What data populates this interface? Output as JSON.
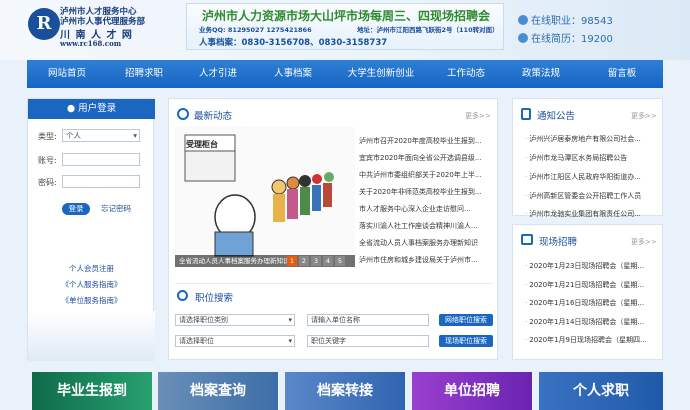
{
  "header": {
    "logo_char": "R",
    "logo_lines": [
      "泸州市人才服务中心",
      "泸州市人事代理服务部",
      "川 南 人 才 网",
      "www.rc168.com"
    ],
    "banner_title": "泸州市人力资源市场大山坪市场每周三、四现场招聘会",
    "banner_qq": "业务QQ: 81295027 1275421866",
    "banner_addr": "地址：泸州市江阳西路飞跃街2号（110转对面）",
    "banner_tel": "人事档案：0830-3156708、0830-3158737",
    "stat_online_job": "在线职业：98543",
    "stat_online_resume": "在线简历：19200"
  },
  "nav": [
    "网站首页",
    "招聘求职",
    "人才引进",
    "人事档案",
    "大学生创新创业",
    "工作动态",
    "政策法规",
    "留言板"
  ],
  "login": {
    "title": "用户登录",
    "type_label": "类型:",
    "type_value": "个人",
    "account_label": "账号:",
    "password_label": "密码:",
    "login_btn": "登录",
    "forgot": "忘记密码",
    "links": [
      "个人会员注册",
      "《个人服务指南》",
      "《单位服务指南》"
    ]
  },
  "news": {
    "title": "最新动态",
    "more": "更多>>",
    "sign": "受理柜台",
    "caption": "全省流动人员人事档案服务办理新知识",
    "pages": [
      "1",
      "2",
      "3",
      "4",
      "5"
    ],
    "items": [
      "泸州市召开2020年度高校毕业生报到...",
      "宜宾市2020年面向全省公开选调县级...",
      "中共泸州市委组织部关于2020年上半...",
      "关于2020年非师范类高校毕业生报到...",
      "市人才服务中心深入企业走访慰问...",
      "落实川渝人社工作座谈会精神川渝人...",
      "全省流动人员人事档案服务办理新知识",
      "泸州市住房和城乡建设局关于泸州市..."
    ]
  },
  "job_search": {
    "title": "职位搜索",
    "sel_category": "请选择职位类别",
    "unit_name": "请输入单位名称",
    "btn_online": "网络职位搜索",
    "sel_position": "请选择职位",
    "keyword": "职位关键字",
    "btn_onsite": "现场职位搜索"
  },
  "notice": {
    "title": "通知公告",
    "more": "更多>>",
    "items": [
      "泸州兴泸居泰房地产有限公司社会...",
      "泸州市龙马潭区水务局招聘公告",
      "泸州市江阳区人民政府华阳街道办...",
      "泸州高新区管委会公开招聘工作人员",
      "泸州市龙驰实业集团有限责任公司..."
    ]
  },
  "onsite": {
    "title": "现场招聘",
    "more": "更多>>",
    "items": [
      "2020年1月23日现场招聘会（星期...",
      "2020年1月21日现场招聘会（星期...",
      "2020年1月16日现场招聘会（星期...",
      "2020年1月14日现场招聘会（星期...",
      "2020年1月9日现场招聘会（星期四..."
    ]
  },
  "tiles": [
    "毕业生报到",
    "档案查询",
    "档案转接",
    "单位招聘",
    "个人求职"
  ],
  "colors": {
    "nav": "#1a66c0",
    "tile_green": "#1f9a6a",
    "tile_blue": "#2f74c4",
    "tile_purple": "#7b2fbf"
  }
}
